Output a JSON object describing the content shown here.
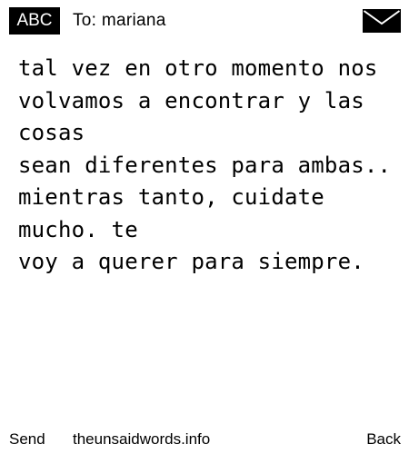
{
  "header": {
    "input_mode_badge": "ABC",
    "recipient_label": "To: mariana",
    "envelope_icon": "envelope-icon"
  },
  "message": {
    "text": "tal vez en otro momento nos\nvolvamos a encontrar y las cosas\nsean diferentes para ambas..\nmientras tanto, cuidate mucho. te\nvoy a querer para siempre."
  },
  "footer": {
    "send_label": "Send",
    "site_label": "theunsaidwords.info",
    "back_label": "Back"
  },
  "colors": {
    "background": "#ffffff",
    "foreground": "#000000"
  }
}
